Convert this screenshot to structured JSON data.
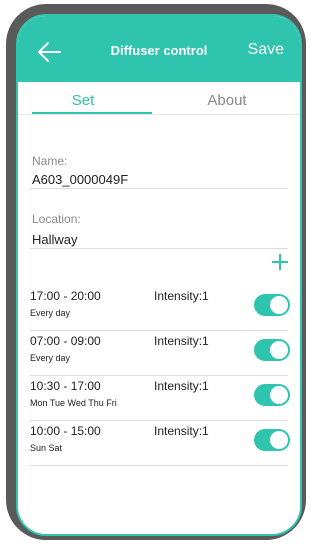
{
  "header": {
    "title": "Diffuser control",
    "save_label": "Save"
  },
  "tabs": [
    {
      "label": "Set",
      "active": true
    },
    {
      "label": "About",
      "active": false
    }
  ],
  "fields": {
    "name_label": "Name:",
    "name_value": "A603_0000049F",
    "location_label": "Location:",
    "location_value": "Hallway"
  },
  "schedules": [
    {
      "time": "17:00 - 20:00",
      "days": "Every day",
      "intensity": "Intensity:1",
      "enabled": true
    },
    {
      "time": "07:00 - 09:00",
      "days": "Every day",
      "intensity": "Intensity:1",
      "enabled": true
    },
    {
      "time": "10:30 - 17:00",
      "days": "Mon Tue Wed Thu Fri",
      "intensity": "Intensity:1",
      "enabled": true
    },
    {
      "time": "10:00 - 15:00",
      "days": "Sun Sat",
      "intensity": "Intensity:1",
      "enabled": true
    }
  ],
  "colors": {
    "accent": "#2ec4ad",
    "device_frame": "#5a5a5a"
  }
}
